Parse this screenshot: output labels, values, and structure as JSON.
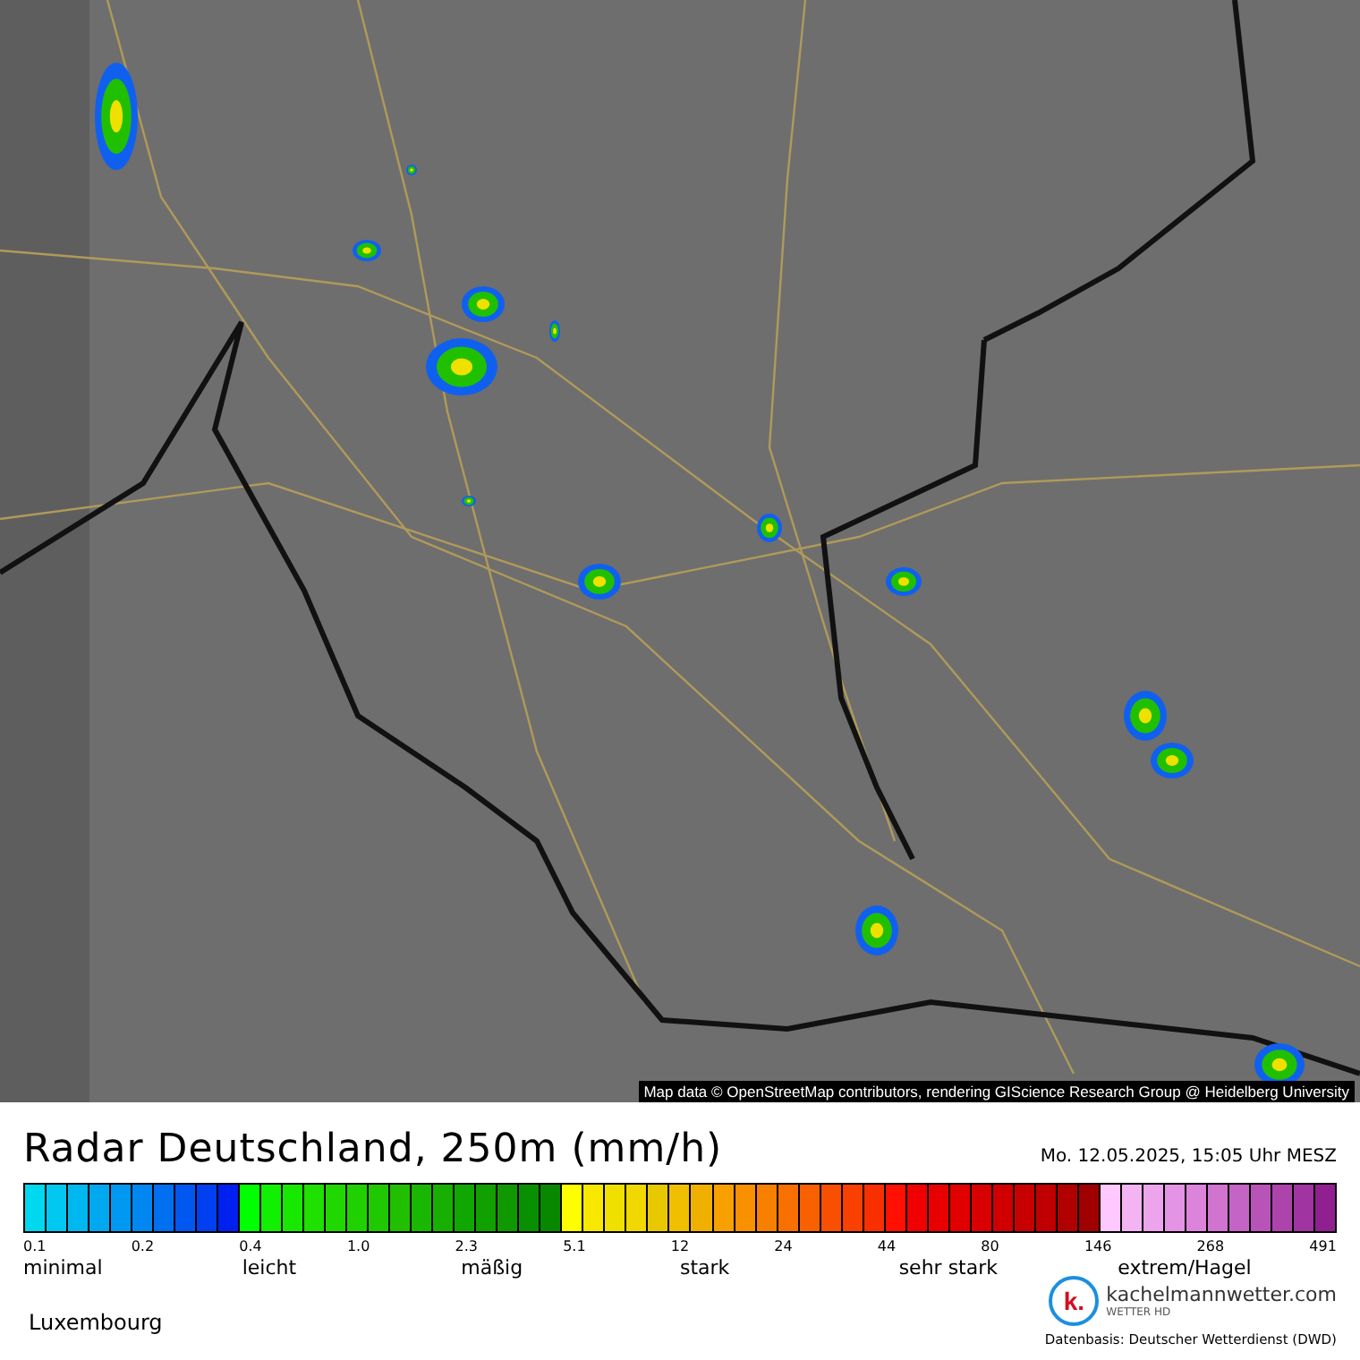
{
  "map": {
    "attribution": "Map data © OpenStreetMap contributors, rendering GIScience Research Group @ Heidelberg University"
  },
  "legend": {
    "title": "Radar Deutschland, 250m (mm/h)",
    "timestamp": "Mo. 12.05.2025, 15:05 Uhr MESZ",
    "swatches": [
      {
        "color": "#00d8f0"
      },
      {
        "color": "#00c8f0"
      },
      {
        "color": "#00b8f0"
      },
      {
        "color": "#00a8f0"
      },
      {
        "color": "#0098f0"
      },
      {
        "color": "#0088f0"
      },
      {
        "color": "#0070f0"
      },
      {
        "color": "#0058f0"
      },
      {
        "color": "#0040f0"
      },
      {
        "color": "#0020f0"
      },
      {
        "color": "#00ff00"
      },
      {
        "color": "#10f000"
      },
      {
        "color": "#18e800"
      },
      {
        "color": "#20e000"
      },
      {
        "color": "#20d800"
      },
      {
        "color": "#20d000"
      },
      {
        "color": "#20c800"
      },
      {
        "color": "#20c000"
      },
      {
        "color": "#18b800"
      },
      {
        "color": "#18b000"
      },
      {
        "color": "#10a800"
      },
      {
        "color": "#10a000"
      },
      {
        "color": "#109800"
      },
      {
        "color": "#089000"
      },
      {
        "color": "#088800"
      },
      {
        "color": "#ffff00"
      },
      {
        "color": "#f8e800"
      },
      {
        "color": "#f0e000"
      },
      {
        "color": "#f0d800"
      },
      {
        "color": "#e8c800"
      },
      {
        "color": "#f0c000"
      },
      {
        "color": "#f0b000"
      },
      {
        "color": "#f8a000"
      },
      {
        "color": "#f89000"
      },
      {
        "color": "#f88000"
      },
      {
        "color": "#f87000"
      },
      {
        "color": "#f86000"
      },
      {
        "color": "#f85000"
      },
      {
        "color": "#f84000"
      },
      {
        "color": "#f83000"
      },
      {
        "color": "#ff1000"
      },
      {
        "color": "#f00000"
      },
      {
        "color": "#e80000"
      },
      {
        "color": "#e00000"
      },
      {
        "color": "#d80000"
      },
      {
        "color": "#d00000"
      },
      {
        "color": "#c80000"
      },
      {
        "color": "#c00000"
      },
      {
        "color": "#b00000"
      },
      {
        "color": "#a00000"
      },
      {
        "color": "#ffc8ff"
      },
      {
        "color": "#f4b4f4"
      },
      {
        "color": "#eca4ec"
      },
      {
        "color": "#e494e4"
      },
      {
        "color": "#dc84dc"
      },
      {
        "color": "#d074d0"
      },
      {
        "color": "#c464c4"
      },
      {
        "color": "#b854b8"
      },
      {
        "color": "#ac44ac"
      },
      {
        "color": "#a034a0"
      },
      {
        "color": "#902090"
      }
    ],
    "ticks": [
      "0.1",
      "0.2",
      "0.4",
      "1.0",
      "2.3",
      "5.1",
      "12",
      "24",
      "44",
      "80",
      "146",
      "268",
      "491"
    ],
    "categories": [
      "minimal",
      "leicht",
      "mäßig",
      "stark",
      "sehr stark",
      "extrem/Hagel"
    ],
    "location": "Luxembourg",
    "brand": {
      "name": "kachelmannwetter.com",
      "tagline": "WETTER HD",
      "mark": "k."
    },
    "source": "Datenbasis: Deutscher Wetterdienst (DWD)"
  }
}
